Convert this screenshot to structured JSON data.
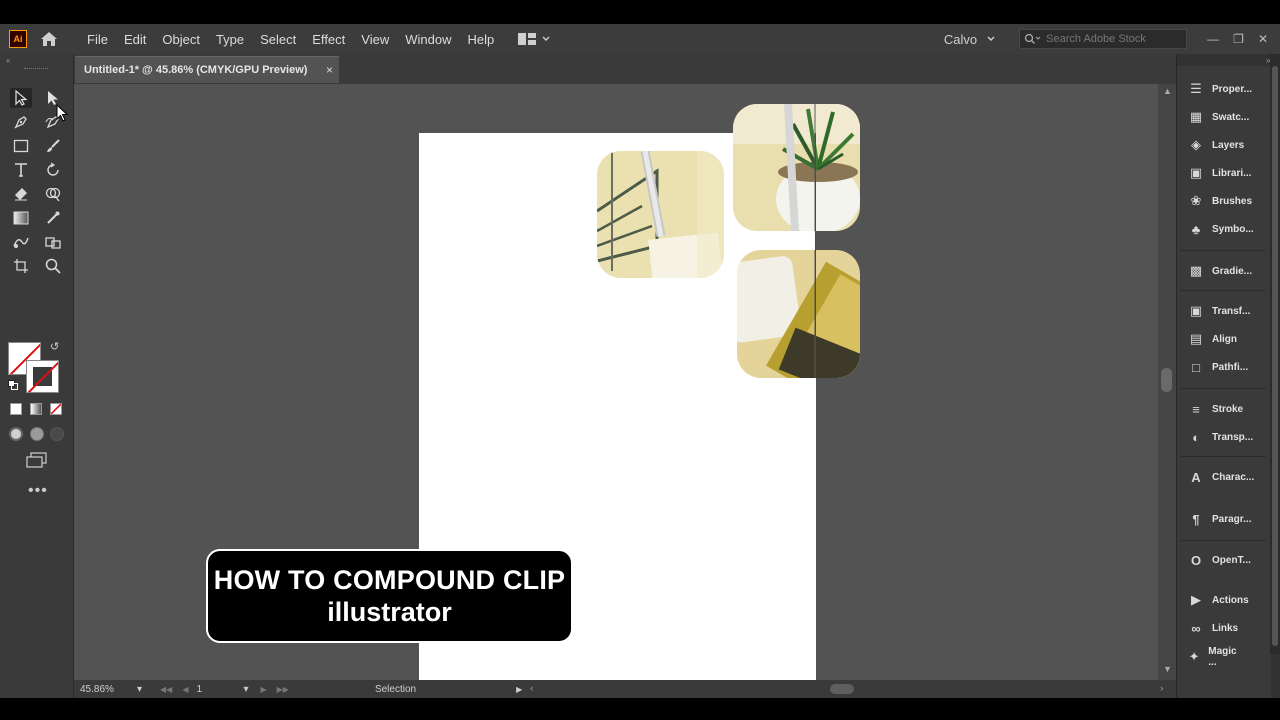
{
  "app": {
    "logo_text": "Ai",
    "menu": [
      "File",
      "Edit",
      "Object",
      "Type",
      "Select",
      "Effect",
      "View",
      "Window",
      "Help"
    ],
    "workspace": "Calvo",
    "stock_search_placeholder": "Search Adobe Stock"
  },
  "document": {
    "tab_title": "Untitled-1* @ 45.86% (CMYK/GPU Preview)",
    "close_glyph": "×"
  },
  "statusbar": {
    "zoom": "45.86%",
    "artboard_number": "1",
    "current_tool": "Selection"
  },
  "panels": [
    {
      "label": "Proper...",
      "icon": "properties-icon"
    },
    {
      "label": "Swatc...",
      "icon": "swatches-icon"
    },
    {
      "label": "Layers",
      "icon": "layers-icon"
    },
    {
      "label": "Librari...",
      "icon": "libraries-icon"
    },
    {
      "label": "Brushes",
      "icon": "brushes-icon"
    },
    {
      "label": "Symbo...",
      "icon": "symbols-icon"
    },
    {
      "label": "Gradie...",
      "icon": "gradient-icon"
    },
    {
      "label": "Transf...",
      "icon": "transform-icon"
    },
    {
      "label": "Align",
      "icon": "align-icon"
    },
    {
      "label": "Pathfi...",
      "icon": "pathfinder-icon"
    },
    {
      "label": "Stroke",
      "icon": "stroke-icon"
    },
    {
      "label": "Transp...",
      "icon": "transparency-icon"
    },
    {
      "label": "Charac...",
      "icon": "character-icon"
    },
    {
      "label": "Paragr...",
      "icon": "paragraph-icon"
    },
    {
      "label": "OpenT...",
      "icon": "opentype-icon"
    },
    {
      "label": "Actions",
      "icon": "actions-icon"
    },
    {
      "label": "Links",
      "icon": "links-icon"
    },
    {
      "label": "Magic ...",
      "icon": "magic-wand-icon"
    }
  ],
  "caption": {
    "line1": "HOW TO COMPOUND CLIP",
    "line2": "illustrator"
  },
  "colors": {
    "accent_logo": "#ff9a00",
    "canvas_bg": "#535353",
    "ui_bg": "#3a3a3a"
  }
}
